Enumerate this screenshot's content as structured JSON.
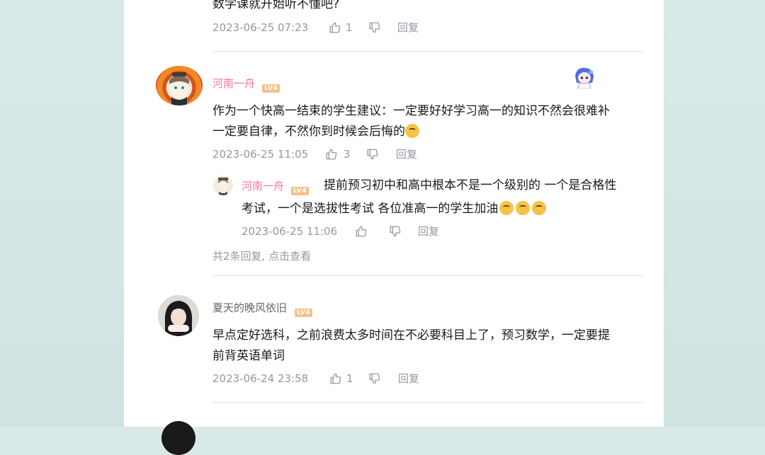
{
  "comments": [
    {
      "tail_text": "数学课就开始听不懂吧?",
      "time": "2023-06-25 07:23",
      "likes": "1",
      "reply_label": "回复"
    },
    {
      "username": "河南一舟",
      "level": "LV4",
      "line1": "作为一个快高一结束的学生建议：一定要好好学习高一的知识不然会很难补",
      "line2": "一定要自律，不然你到时候会后悔的",
      "time": "2023-06-25 11:05",
      "likes": "3",
      "reply_label": "回复",
      "sub_reply": {
        "username": "河南一舟",
        "level": "LV4",
        "line1": "提前预习初中和高中根本不是一个级别的 一个是合格性",
        "line2": "考试，一个是选拔性考试   各位准高一的学生加油",
        "time": "2023-06-25 11:06",
        "reply_label": "回复"
      },
      "more_replies": "共2条回复, 点击查看"
    },
    {
      "username": "夏天的晚风依旧",
      "level": "LV4",
      "line1": "早点定好选科，之前浪费太多时间在不必要科目上了，预习数学，一定要提",
      "line2": "前背英语单词",
      "time": "2023-06-24 23:58",
      "likes": "1",
      "reply_label": "回复"
    }
  ],
  "colors": {
    "username_pink": "#fb7299",
    "meta_gray": "#9499a0",
    "level_badge": "#f6c08a",
    "backdrop": "#d5e7e5"
  }
}
